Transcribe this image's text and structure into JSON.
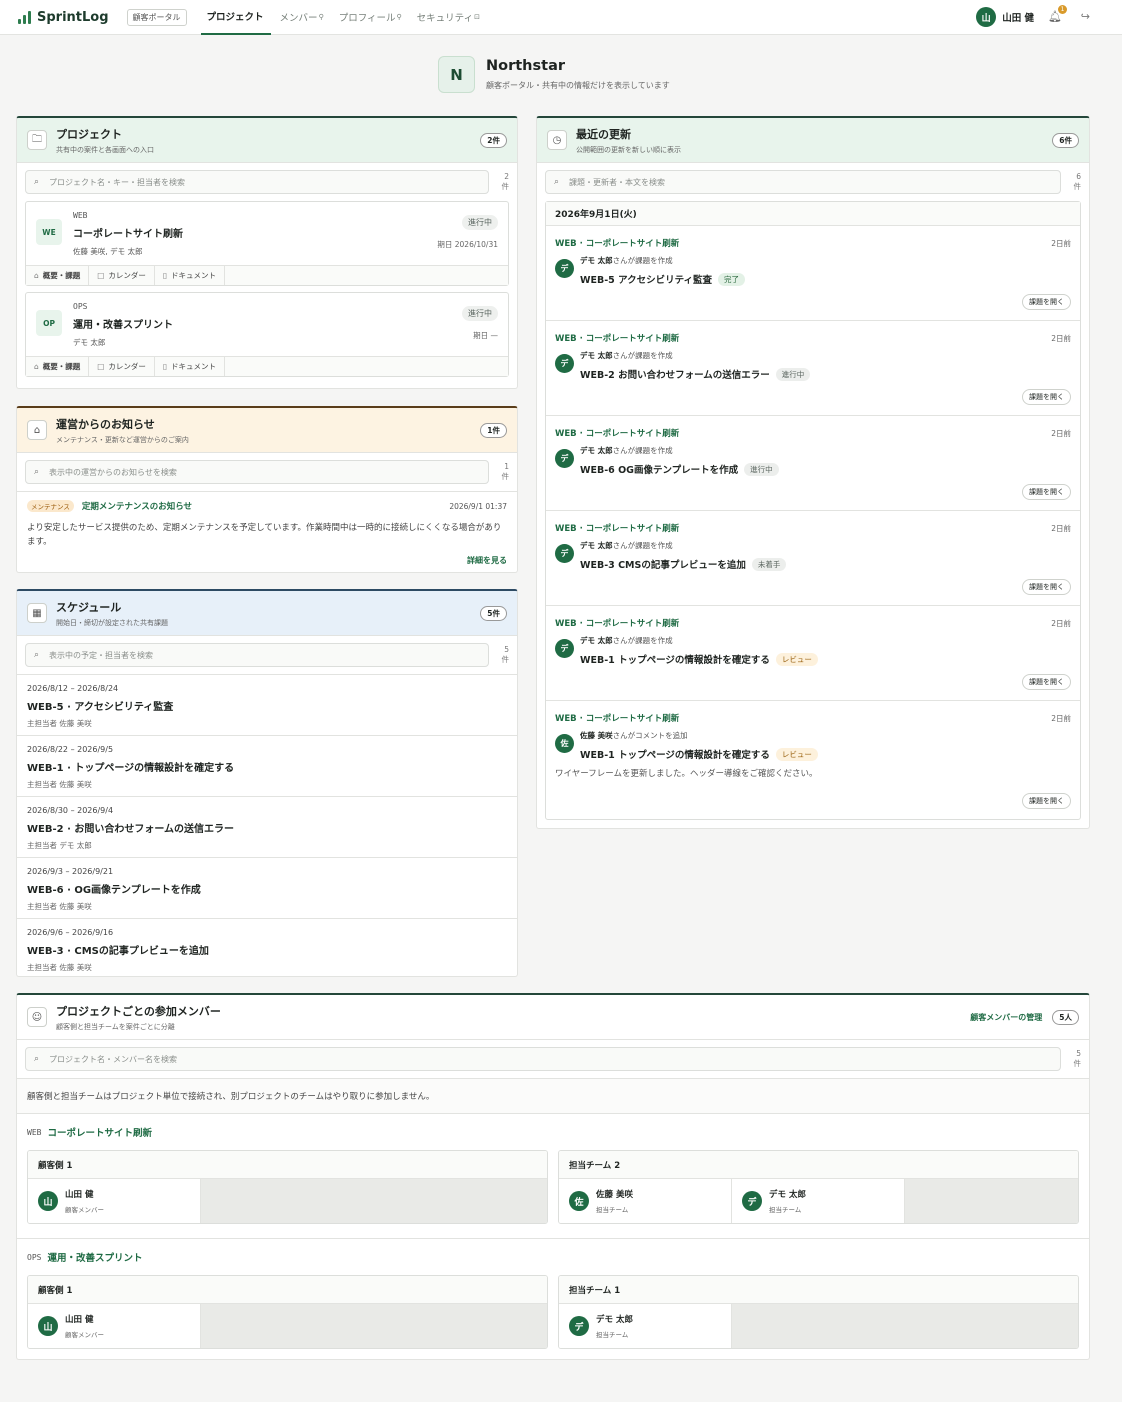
{
  "app": {
    "name": "SprintLog",
    "portal_tag": "顧客ポータル"
  },
  "nav": [
    {
      "label": "プロジェクト",
      "active": true,
      "icon": ""
    },
    {
      "label": "メンバー",
      "active": false,
      "icon": "⚲"
    },
    {
      "label": "プロフィール",
      "active": false,
      "icon": "⚲"
    },
    {
      "label": "セキュリティ",
      "active": false,
      "icon": "⊡"
    }
  ],
  "user": {
    "avatar": "山",
    "name": "山田 健",
    "notifications": "1"
  },
  "tenant": {
    "initial": "N",
    "name": "Northstar",
    "subtitle": "顧客ポータル・共有中の情報だけを表示しています"
  },
  "projects": {
    "title": "プロジェクト",
    "subtitle": "共有中の案件と各画面への入口",
    "count": "2件",
    "search_placeholder": "プロジェクト名・キー・担当者を検索",
    "search_count": "2件",
    "items": [
      {
        "badge": "WE",
        "key": "WEB",
        "name": "コーポレートサイト刷新",
        "members": "佐藤 美咲, デモ 太郎",
        "status": "進行中",
        "due": "期日 2026/10/31"
      },
      {
        "badge": "OP",
        "key": "OPS",
        "name": "運用・改善スプリント",
        "members": "デモ 太郎",
        "status": "進行中",
        "due": "期日 —"
      }
    ],
    "tabs": [
      "概要・課題",
      "カレンダー",
      "ドキュメント"
    ]
  },
  "notices": {
    "title": "運営からのお知らせ",
    "subtitle": "メンテナンス・更新など運営からのご案内",
    "count": "1件",
    "search_placeholder": "表示中の運営からのお知らせを検索",
    "search_count": "1件",
    "item": {
      "tag": "メンテナンス",
      "title": "定期メンテナンスのお知らせ",
      "date": "2026/9/1 01:37",
      "body": "より安定したサービス提供のため、定期メンテナンスを予定しています。作業時間中は一時的に接続しにくくなる場合があります。",
      "more": "詳細を見る"
    }
  },
  "schedule": {
    "title": "スケジュール",
    "subtitle": "開始日・締切が設定された共有課題",
    "count": "5件",
    "search_placeholder": "表示中の予定・担当者を検索",
    "search_count": "5件",
    "items": [
      {
        "dates": "2026/8/12 – 2026/8/24",
        "title": "WEB-5 · アクセシビリティ監査",
        "assignee": "主担当者 佐藤 美咲"
      },
      {
        "dates": "2026/8/22 – 2026/9/5",
        "title": "WEB-1 · トップページの情報設計を確定する",
        "assignee": "主担当者 佐藤 美咲"
      },
      {
        "dates": "2026/8/30 – 2026/9/4",
        "title": "WEB-2 · お問い合わせフォームの送信エラー",
        "assignee": "主担当者 デモ 太郎"
      },
      {
        "dates": "2026/9/3 – 2026/9/21",
        "title": "WEB-6 · OG画像テンプレートを作成",
        "assignee": "主担当者 佐藤 美咲"
      },
      {
        "dates": "2026/9/6 – 2026/9/16",
        "title": "WEB-3 · CMSの記事プレビューを追加",
        "assignee": "主担当者 佐藤 美咲"
      }
    ]
  },
  "updates": {
    "title": "最近の更新",
    "subtitle": "公開範囲の更新を新しい順に表示",
    "count": "6件",
    "search_placeholder": "課題・更新者・本文を検索",
    "search_count": "6件",
    "date": "2026年9月1日(火)",
    "items": [
      {
        "project": "WEB · コーポレートサイト刷新",
        "ago": "2日前",
        "avatar": "デ",
        "actor": "デモ 太郎",
        "action": "さんが課題を作成",
        "issue": "WEB-5 アクセシビリティ監査",
        "status": "完了",
        "status_type": "done",
        "comment": "",
        "open": "課題を開く"
      },
      {
        "project": "WEB · コーポレートサイト刷新",
        "ago": "2日前",
        "avatar": "デ",
        "actor": "デモ 太郎",
        "action": "さんが課題を作成",
        "issue": "WEB-2 お問い合わせフォームの送信エラー",
        "status": "進行中",
        "status_type": "prog",
        "comment": "",
        "open": "課題を開く"
      },
      {
        "project": "WEB · コーポレートサイト刷新",
        "ago": "2日前",
        "avatar": "デ",
        "actor": "デモ 太郎",
        "action": "さんが課題を作成",
        "issue": "WEB-6 OG画像テンプレートを作成",
        "status": "進行中",
        "status_type": "prog",
        "comment": "",
        "open": "課題を開く"
      },
      {
        "project": "WEB · コーポレートサイト刷新",
        "ago": "2日前",
        "avatar": "デ",
        "actor": "デモ 太郎",
        "action": "さんが課題を作成",
        "issue": "WEB-3 CMSの記事プレビューを追加",
        "status": "未着手",
        "status_type": "todo",
        "comment": "",
        "open": "課題を開く"
      },
      {
        "project": "WEB · コーポレートサイト刷新",
        "ago": "2日前",
        "avatar": "デ",
        "actor": "デモ 太郎",
        "action": "さんが課題を作成",
        "issue": "WEB-1 トップページの情報設計を確定する",
        "status": "レビュー",
        "status_type": "rev",
        "comment": "",
        "open": "課題を開く"
      },
      {
        "project": "WEB · コーポレートサイト刷新",
        "ago": "2日前",
        "avatar": "佐",
        "actor": "佐藤 美咲",
        "action": "さんがコメントを追加",
        "issue": "WEB-1 トップページの情報設計を確定する",
        "status": "レビュー",
        "status_type": "rev",
        "comment": "ワイヤーフレームを更新しました。ヘッダー導線をご確認ください。",
        "open": "課題を開く"
      }
    ]
  },
  "members": {
    "title": "プロジェクトごとの参加メンバー",
    "subtitle": "顧客側と担当チームを案件ごとに分離",
    "manage": "顧客メンバーの管理",
    "count": "5人",
    "search_placeholder": "プロジェクト名・メンバー名を検索",
    "search_count": "5件",
    "note": "顧客側と担当チームはプロジェクト単位で接続され、別プロジェクトのチームはやり取りに参加しません。",
    "projects": [
      {
        "key": "WEB",
        "name": "コーポレートサイト刷新",
        "customer": {
          "label": "顧客側 1",
          "people": [
            {
              "avatar": "山",
              "name": "山田 健",
              "role": "顧客メンバー"
            }
          ]
        },
        "team": {
          "label": "担当チーム 2",
          "people": [
            {
              "avatar": "佐",
              "name": "佐藤 美咲",
              "role": "担当チーム"
            },
            {
              "avatar": "デ",
              "name": "デモ 太郎",
              "role": "担当チーム"
            }
          ]
        }
      },
      {
        "key": "OPS",
        "name": "運用・改善スプリント",
        "customer": {
          "label": "顧客側 1",
          "people": [
            {
              "avatar": "山",
              "name": "山田 健",
              "role": "顧客メンバー"
            }
          ]
        },
        "team": {
          "label": "担当チーム 1",
          "people": [
            {
              "avatar": "デ",
              "name": "デモ 太郎",
              "role": "担当チーム"
            }
          ]
        }
      }
    ]
  }
}
